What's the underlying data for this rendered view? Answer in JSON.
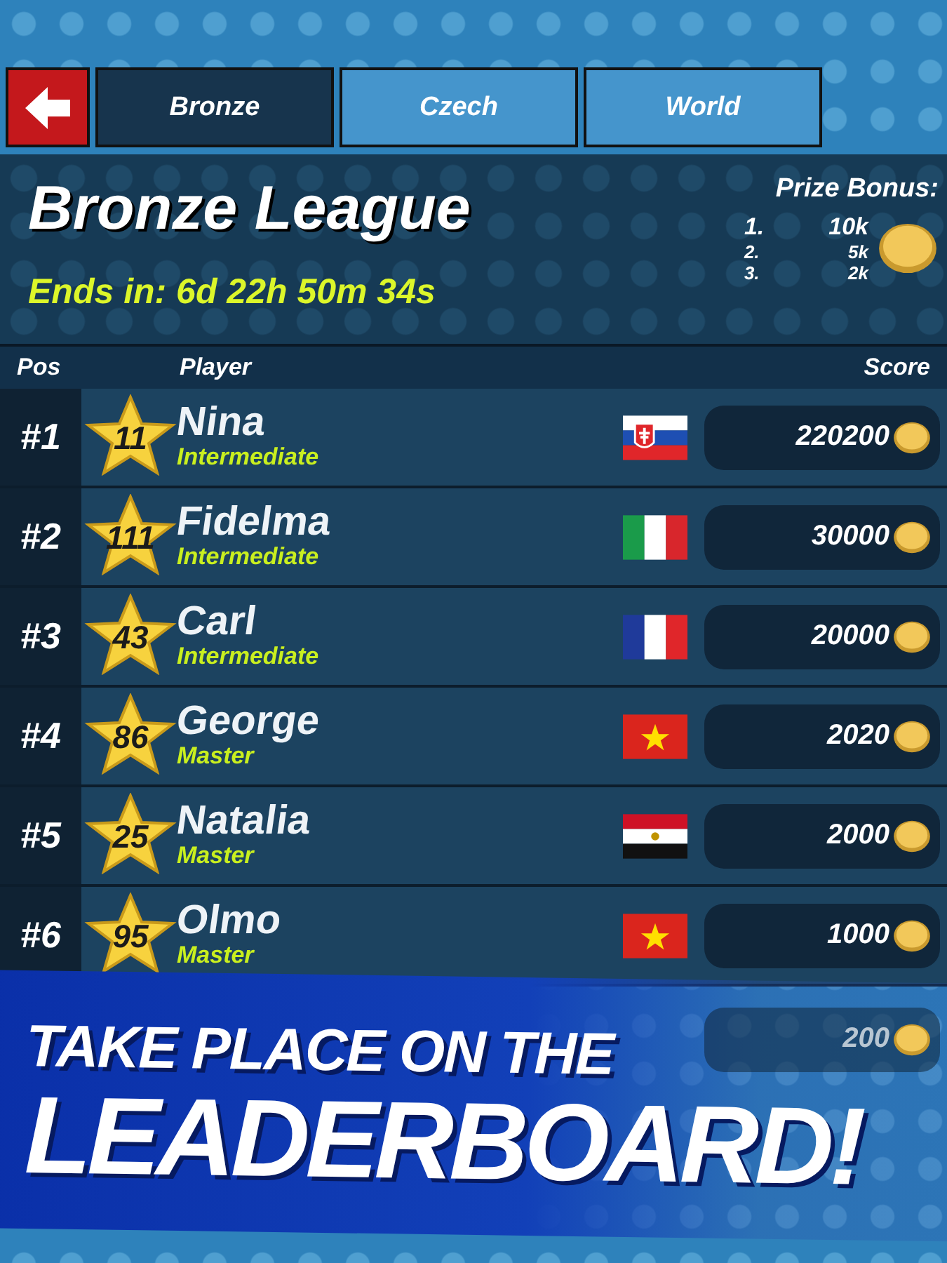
{
  "tabs": [
    {
      "label": "Bronze",
      "selected": true
    },
    {
      "label": "Czech",
      "selected": false
    },
    {
      "label": "World",
      "selected": false
    }
  ],
  "league": {
    "title": "Bronze League",
    "ends": "Ends in: 6d 22h 50m 34s"
  },
  "prize_bonus": {
    "title": "Prize Bonus:",
    "prizes": [
      {
        "place": "1.",
        "amount": "10k"
      },
      {
        "place": "2.",
        "amount": "5k"
      },
      {
        "place": "3.",
        "amount": "2k"
      }
    ]
  },
  "columns": [
    "Pos",
    "Player",
    "Score"
  ],
  "rows": [
    {
      "pos": "#1",
      "level": "11",
      "name": "Nina",
      "rank": "Intermediate",
      "kind": "sk",
      "score": "220200"
    },
    {
      "pos": "#2",
      "level": "111",
      "name": "Fidelma",
      "rank": "Intermediate",
      "kind": "it",
      "score": "30000"
    },
    {
      "pos": "#3",
      "level": "43",
      "name": "Carl",
      "rank": "Intermediate",
      "kind": "fr",
      "score": "20000"
    },
    {
      "pos": "#4",
      "level": "86",
      "name": "George",
      "rank": "Master",
      "kind": "vn",
      "score": "2020"
    },
    {
      "pos": "#5",
      "level": "25",
      "name": "Natalia",
      "rank": "Master",
      "kind": "eg",
      "score": "2000"
    },
    {
      "pos": "#6",
      "level": "95",
      "name": "Olmo",
      "rank": "Master",
      "kind": "vn",
      "score": "1000"
    }
  ],
  "partial_row": {
    "score": "200"
  },
  "banner": {
    "line_1": "TAKE PLACE ON THE",
    "line_2": "LEADERBOARD!"
  }
}
